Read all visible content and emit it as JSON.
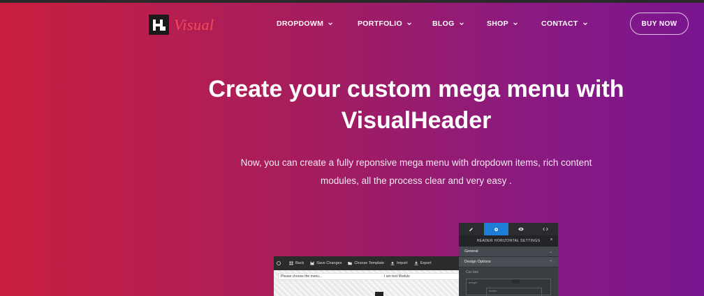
{
  "colors": {
    "gradient_left": "#c91f3f",
    "gradient_right": "#7a1590",
    "logo_text": "#f34a5e",
    "panel_active_tab": "#1e7dd6"
  },
  "brand": {
    "logo_icon": "h-logo-icon",
    "logo_text": "Visual"
  },
  "nav": {
    "items": [
      {
        "label": "DROPDOWM",
        "icon": "chevron-down-icon"
      },
      {
        "label": "PORTFOLIO",
        "icon": "chevron-down-icon"
      },
      {
        "label": "BLOG",
        "icon": "chevron-down-icon"
      },
      {
        "label": "SHOP",
        "icon": "chevron-down-icon"
      },
      {
        "label": "CONTACT",
        "icon": "chevron-down-icon"
      }
    ],
    "cta_label": "BUY NOW"
  },
  "hero": {
    "title_line1": "Create your custom mega menu with",
    "title_line2": "VisualHeader",
    "subtitle_line1": "Now, you can create a fully reponsive mega menu with dropdown items, rich content",
    "subtitle_line2": "modules, all the process clear and very easy ."
  },
  "builder": {
    "toolbar": [
      {
        "label": "",
        "icon": "wordpress-icon"
      },
      {
        "label": "Back",
        "icon": "grid-icon"
      },
      {
        "label": "Save Changes",
        "icon": "save-icon"
      },
      {
        "label": "Choose Template",
        "icon": "folder-icon"
      },
      {
        "label": "Import",
        "icon": "upload-icon"
      },
      {
        "label": "Export",
        "icon": "download-icon"
      }
    ],
    "menu_placeholder": "Please choose the menu...",
    "text_module": "I am text Module",
    "panel": {
      "tabs": [
        "pencil-icon",
        "gear-icon",
        "eye-icon",
        "code-icon"
      ],
      "title": "HEADER HORIZONTAL SETTINGS",
      "close_icon": "close-icon",
      "rows": [
        {
          "label": "General",
          "arrow": "chevron-down-icon"
        },
        {
          "label": "Design Options",
          "arrow": "chevron-up-icon"
        }
      ],
      "section_label": "Css box",
      "box_outer_label": "margin",
      "box_inner_label": "border"
    }
  }
}
